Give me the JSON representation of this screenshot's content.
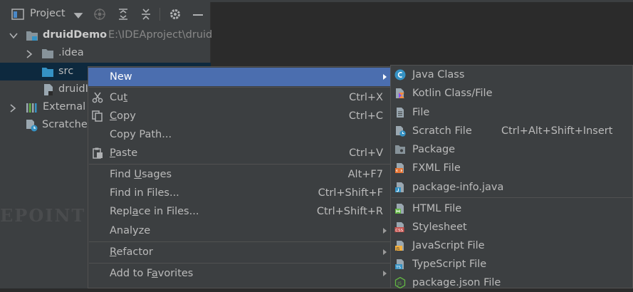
{
  "toolbar": {
    "title": "Project",
    "icons": [
      "project-view-icon",
      "chevron-down-icon",
      "locate-icon",
      "expand-all-icon",
      "collapse-all-icon",
      "gear-icon",
      "minimize-icon"
    ]
  },
  "tree": {
    "root": {
      "label": "druidDemo",
      "path": "E:\\IDEAproject\\druid"
    },
    "items": [
      {
        "label": ".idea"
      },
      {
        "label": "src"
      },
      {
        "label": "druidI"
      },
      {
        "label": "External L"
      },
      {
        "label": "Scratches"
      }
    ]
  },
  "watermark": "EPOINT",
  "context_menu": {
    "items": [
      {
        "label": "New",
        "shortcut": "",
        "submenu": true
      },
      {
        "label": "Cut",
        "mnemonic": "t",
        "shortcut": "Ctrl+X"
      },
      {
        "label": "Copy",
        "mnemonic": "C",
        "shortcut": "Ctrl+C"
      },
      {
        "label": "Copy Path...",
        "shortcut": ""
      },
      {
        "label": "Paste",
        "mnemonic": "P",
        "shortcut": "Ctrl+V"
      },
      {
        "label": "Find Usages",
        "shortcut": "Alt+F7"
      },
      {
        "label": "Find in Files...",
        "shortcut": "Ctrl+Shift+F"
      },
      {
        "label": "Replace in Files...",
        "shortcut": "Ctrl+Shift+R"
      },
      {
        "label": "Analyze",
        "shortcut": "",
        "submenu": true
      },
      {
        "label": "Refactor",
        "shortcut": "",
        "submenu": true
      },
      {
        "label": "Add to Favorites",
        "shortcut": "",
        "submenu": true
      }
    ]
  },
  "new_submenu": {
    "items": [
      {
        "label": "Java Class",
        "icon": "java-class-icon"
      },
      {
        "label": "Kotlin Class/File",
        "icon": "kotlin-icon"
      },
      {
        "label": "File",
        "icon": "file-icon"
      },
      {
        "label": "Scratch File",
        "icon": "scratch-file-icon",
        "shortcut": "Ctrl+Alt+Shift+Insert"
      },
      {
        "label": "Package",
        "icon": "package-icon"
      },
      {
        "label": "FXML File",
        "icon": "fxml-icon"
      },
      {
        "label": "package-info.java",
        "icon": "package-info-icon"
      },
      {
        "label": "HTML File",
        "icon": "html-icon"
      },
      {
        "label": "Stylesheet",
        "icon": "css-icon"
      },
      {
        "label": "JavaScript File",
        "icon": "js-icon"
      },
      {
        "label": "TypeScript File",
        "icon": "ts-icon"
      },
      {
        "label": "package.json File",
        "icon": "nodejs-icon"
      }
    ]
  },
  "colors": {
    "editor_bg": "#2b2b2b",
    "panel_bg": "#3c3f41",
    "menu_highlight": "#4b6eaf",
    "text": "#bbbbbb"
  }
}
